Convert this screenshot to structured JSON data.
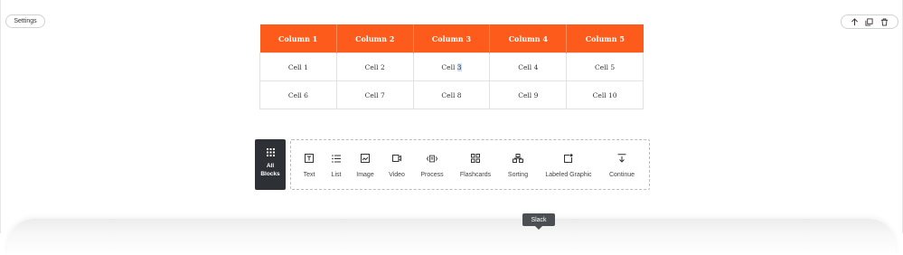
{
  "toolbar": {
    "settings_label": "Settings"
  },
  "block_actions": [
    {
      "icon": "arrow-up-icon"
    },
    {
      "icon": "duplicate-icon"
    },
    {
      "icon": "trash-icon"
    }
  ],
  "table": {
    "headers": [
      "Column 1",
      "Column 2",
      "Column 3",
      "Column 4",
      "Column 5"
    ],
    "rows": [
      [
        "Cell 1",
        "Cell 2",
        "Cell 3",
        "Cell 4",
        "Cell 5"
      ],
      [
        "Cell 6",
        "Cell 7",
        "Cell 8",
        "Cell 9",
        "Cell 10"
      ]
    ],
    "header_color": "#fc5b1b"
  },
  "picker": {
    "all_blocks": {
      "line1": "All",
      "line2": "Blocks"
    },
    "items": [
      {
        "label": "Text",
        "icon": "text-icon"
      },
      {
        "label": "List",
        "icon": "list-icon"
      },
      {
        "label": "Image",
        "icon": "image-icon"
      },
      {
        "label": "Video",
        "icon": "video-icon"
      },
      {
        "label": "Process",
        "icon": "process-icon"
      },
      {
        "label": "Flashcards",
        "icon": "flashcards-icon"
      },
      {
        "label": "Sorting",
        "icon": "sorting-icon"
      },
      {
        "label": "Labeled Graphic",
        "icon": "labeled-graphic-icon"
      },
      {
        "label": "Continue",
        "icon": "continue-icon"
      }
    ]
  },
  "tooltip": {
    "label": "Slack"
  }
}
